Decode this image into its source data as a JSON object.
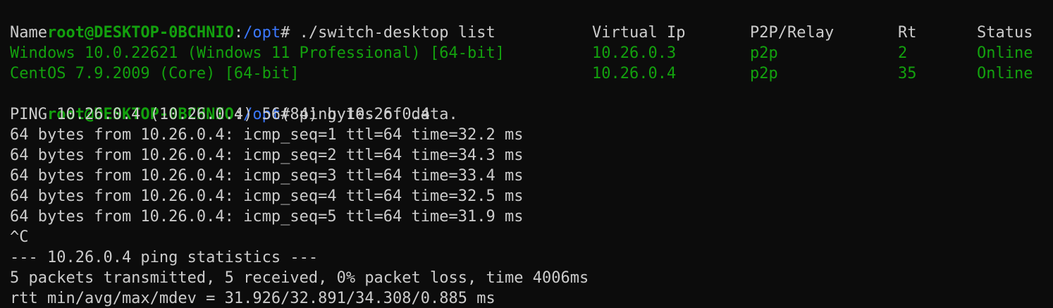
{
  "prompt": {
    "user_host": "root@DESKTOP-0BCHNIO",
    "colon": ":",
    "path": "/opt",
    "hash": "#"
  },
  "commands": {
    "first": " ./switch-desktop list",
    "second": " ping 10.26.0.4"
  },
  "device_table": {
    "headers": {
      "name": "Name",
      "virtual_ip": "Virtual Ip",
      "mode": "P2P/Relay",
      "rt": "Rt",
      "status": "Status"
    },
    "rows": [
      {
        "name": "Windows 10.0.22621 (Windows 11 Professional) [64-bit]",
        "virtual_ip": "10.26.0.3",
        "mode": "p2p",
        "rt": "2",
        "status": "Online"
      },
      {
        "name": "CentOS 7.9.2009 (Core) [64-bit]",
        "virtual_ip": "10.26.0.4",
        "mode": "p2p",
        "rt": "35",
        "status": "Online"
      }
    ]
  },
  "ping_output": {
    "header": "PING 10.26.0.4 (10.26.0.4) 56(84) bytes of data.",
    "replies": [
      "64 bytes from 10.26.0.4: icmp_seq=1 ttl=64 time=32.2 ms",
      "64 bytes from 10.26.0.4: icmp_seq=2 ttl=64 time=34.3 ms",
      "64 bytes from 10.26.0.4: icmp_seq=3 ttl=64 time=33.4 ms",
      "64 bytes from 10.26.0.4: icmp_seq=4 ttl=64 time=32.5 ms",
      "64 bytes from 10.26.0.4: icmp_seq=5 ttl=64 time=31.9 ms"
    ],
    "interrupt": "^C",
    "stats_title": "--- 10.26.0.4 ping statistics ---",
    "stats_summary": "5 packets transmitted, 5 received, 0% packet loss, time 4006ms",
    "rtt": "rtt min/avg/max/mdev = 31.926/32.891/34.308/0.885 ms"
  },
  "colors": {
    "background": "#0c0c0c",
    "text": "#cccccc",
    "prompt_user": "#13a10e",
    "prompt_path": "#3b78ff",
    "online_rows": "#13a10e"
  }
}
